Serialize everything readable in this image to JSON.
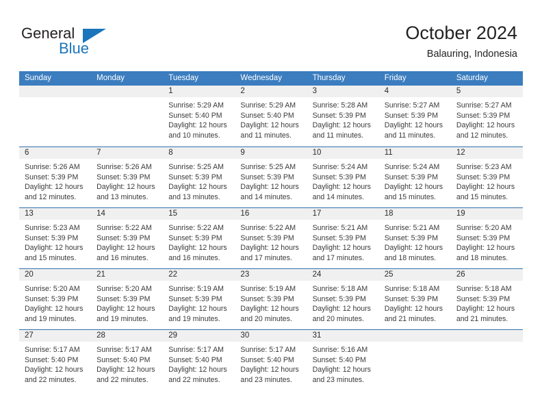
{
  "brand": {
    "name_top": "General",
    "name_bottom": "Blue",
    "primary_color": "#1b75bb"
  },
  "header": {
    "title": "October 2024",
    "subtitle": "Balauring, Indonesia"
  },
  "theme": {
    "header_row_bg": "#3b7dbf",
    "row_divider": "#2f6fab",
    "day_band_bg": "#f0f0f0",
    "text_color": "#3a3a3a"
  },
  "weekdays": [
    "Sunday",
    "Monday",
    "Tuesday",
    "Wednesday",
    "Thursday",
    "Friday",
    "Saturday"
  ],
  "weeks": [
    [
      {
        "day": "",
        "sunrise": "",
        "sunset": "",
        "daylight_line1": "",
        "daylight_line2": ""
      },
      {
        "day": "",
        "sunrise": "",
        "sunset": "",
        "daylight_line1": "",
        "daylight_line2": ""
      },
      {
        "day": "1",
        "sunrise": "Sunrise: 5:29 AM",
        "sunset": "Sunset: 5:40 PM",
        "daylight_line1": "Daylight: 12 hours",
        "daylight_line2": "and 10 minutes."
      },
      {
        "day": "2",
        "sunrise": "Sunrise: 5:29 AM",
        "sunset": "Sunset: 5:40 PM",
        "daylight_line1": "Daylight: 12 hours",
        "daylight_line2": "and 11 minutes."
      },
      {
        "day": "3",
        "sunrise": "Sunrise: 5:28 AM",
        "sunset": "Sunset: 5:39 PM",
        "daylight_line1": "Daylight: 12 hours",
        "daylight_line2": "and 11 minutes."
      },
      {
        "day": "4",
        "sunrise": "Sunrise: 5:27 AM",
        "sunset": "Sunset: 5:39 PM",
        "daylight_line1": "Daylight: 12 hours",
        "daylight_line2": "and 11 minutes."
      },
      {
        "day": "5",
        "sunrise": "Sunrise: 5:27 AM",
        "sunset": "Sunset: 5:39 PM",
        "daylight_line1": "Daylight: 12 hours",
        "daylight_line2": "and 12 minutes."
      }
    ],
    [
      {
        "day": "6",
        "sunrise": "Sunrise: 5:26 AM",
        "sunset": "Sunset: 5:39 PM",
        "daylight_line1": "Daylight: 12 hours",
        "daylight_line2": "and 12 minutes."
      },
      {
        "day": "7",
        "sunrise": "Sunrise: 5:26 AM",
        "sunset": "Sunset: 5:39 PM",
        "daylight_line1": "Daylight: 12 hours",
        "daylight_line2": "and 13 minutes."
      },
      {
        "day": "8",
        "sunrise": "Sunrise: 5:25 AM",
        "sunset": "Sunset: 5:39 PM",
        "daylight_line1": "Daylight: 12 hours",
        "daylight_line2": "and 13 minutes."
      },
      {
        "day": "9",
        "sunrise": "Sunrise: 5:25 AM",
        "sunset": "Sunset: 5:39 PM",
        "daylight_line1": "Daylight: 12 hours",
        "daylight_line2": "and 14 minutes."
      },
      {
        "day": "10",
        "sunrise": "Sunrise: 5:24 AM",
        "sunset": "Sunset: 5:39 PM",
        "daylight_line1": "Daylight: 12 hours",
        "daylight_line2": "and 14 minutes."
      },
      {
        "day": "11",
        "sunrise": "Sunrise: 5:24 AM",
        "sunset": "Sunset: 5:39 PM",
        "daylight_line1": "Daylight: 12 hours",
        "daylight_line2": "and 15 minutes."
      },
      {
        "day": "12",
        "sunrise": "Sunrise: 5:23 AM",
        "sunset": "Sunset: 5:39 PM",
        "daylight_line1": "Daylight: 12 hours",
        "daylight_line2": "and 15 minutes."
      }
    ],
    [
      {
        "day": "13",
        "sunrise": "Sunrise: 5:23 AM",
        "sunset": "Sunset: 5:39 PM",
        "daylight_line1": "Daylight: 12 hours",
        "daylight_line2": "and 15 minutes."
      },
      {
        "day": "14",
        "sunrise": "Sunrise: 5:22 AM",
        "sunset": "Sunset: 5:39 PM",
        "daylight_line1": "Daylight: 12 hours",
        "daylight_line2": "and 16 minutes."
      },
      {
        "day": "15",
        "sunrise": "Sunrise: 5:22 AM",
        "sunset": "Sunset: 5:39 PM",
        "daylight_line1": "Daylight: 12 hours",
        "daylight_line2": "and 16 minutes."
      },
      {
        "day": "16",
        "sunrise": "Sunrise: 5:22 AM",
        "sunset": "Sunset: 5:39 PM",
        "daylight_line1": "Daylight: 12 hours",
        "daylight_line2": "and 17 minutes."
      },
      {
        "day": "17",
        "sunrise": "Sunrise: 5:21 AM",
        "sunset": "Sunset: 5:39 PM",
        "daylight_line1": "Daylight: 12 hours",
        "daylight_line2": "and 17 minutes."
      },
      {
        "day": "18",
        "sunrise": "Sunrise: 5:21 AM",
        "sunset": "Sunset: 5:39 PM",
        "daylight_line1": "Daylight: 12 hours",
        "daylight_line2": "and 18 minutes."
      },
      {
        "day": "19",
        "sunrise": "Sunrise: 5:20 AM",
        "sunset": "Sunset: 5:39 PM",
        "daylight_line1": "Daylight: 12 hours",
        "daylight_line2": "and 18 minutes."
      }
    ],
    [
      {
        "day": "20",
        "sunrise": "Sunrise: 5:20 AM",
        "sunset": "Sunset: 5:39 PM",
        "daylight_line1": "Daylight: 12 hours",
        "daylight_line2": "and 19 minutes."
      },
      {
        "day": "21",
        "sunrise": "Sunrise: 5:20 AM",
        "sunset": "Sunset: 5:39 PM",
        "daylight_line1": "Daylight: 12 hours",
        "daylight_line2": "and 19 minutes."
      },
      {
        "day": "22",
        "sunrise": "Sunrise: 5:19 AM",
        "sunset": "Sunset: 5:39 PM",
        "daylight_line1": "Daylight: 12 hours",
        "daylight_line2": "and 19 minutes."
      },
      {
        "day": "23",
        "sunrise": "Sunrise: 5:19 AM",
        "sunset": "Sunset: 5:39 PM",
        "daylight_line1": "Daylight: 12 hours",
        "daylight_line2": "and 20 minutes."
      },
      {
        "day": "24",
        "sunrise": "Sunrise: 5:18 AM",
        "sunset": "Sunset: 5:39 PM",
        "daylight_line1": "Daylight: 12 hours",
        "daylight_line2": "and 20 minutes."
      },
      {
        "day": "25",
        "sunrise": "Sunrise: 5:18 AM",
        "sunset": "Sunset: 5:39 PM",
        "daylight_line1": "Daylight: 12 hours",
        "daylight_line2": "and 21 minutes."
      },
      {
        "day": "26",
        "sunrise": "Sunrise: 5:18 AM",
        "sunset": "Sunset: 5:39 PM",
        "daylight_line1": "Daylight: 12 hours",
        "daylight_line2": "and 21 minutes."
      }
    ],
    [
      {
        "day": "27",
        "sunrise": "Sunrise: 5:17 AM",
        "sunset": "Sunset: 5:40 PM",
        "daylight_line1": "Daylight: 12 hours",
        "daylight_line2": "and 22 minutes."
      },
      {
        "day": "28",
        "sunrise": "Sunrise: 5:17 AM",
        "sunset": "Sunset: 5:40 PM",
        "daylight_line1": "Daylight: 12 hours",
        "daylight_line2": "and 22 minutes."
      },
      {
        "day": "29",
        "sunrise": "Sunrise: 5:17 AM",
        "sunset": "Sunset: 5:40 PM",
        "daylight_line1": "Daylight: 12 hours",
        "daylight_line2": "and 22 minutes."
      },
      {
        "day": "30",
        "sunrise": "Sunrise: 5:17 AM",
        "sunset": "Sunset: 5:40 PM",
        "daylight_line1": "Daylight: 12 hours",
        "daylight_line2": "and 23 minutes."
      },
      {
        "day": "31",
        "sunrise": "Sunrise: 5:16 AM",
        "sunset": "Sunset: 5:40 PM",
        "daylight_line1": "Daylight: 12 hours",
        "daylight_line2": "and 23 minutes."
      },
      {
        "day": "",
        "sunrise": "",
        "sunset": "",
        "daylight_line1": "",
        "daylight_line2": ""
      },
      {
        "day": "",
        "sunrise": "",
        "sunset": "",
        "daylight_line1": "",
        "daylight_line2": ""
      }
    ]
  ]
}
